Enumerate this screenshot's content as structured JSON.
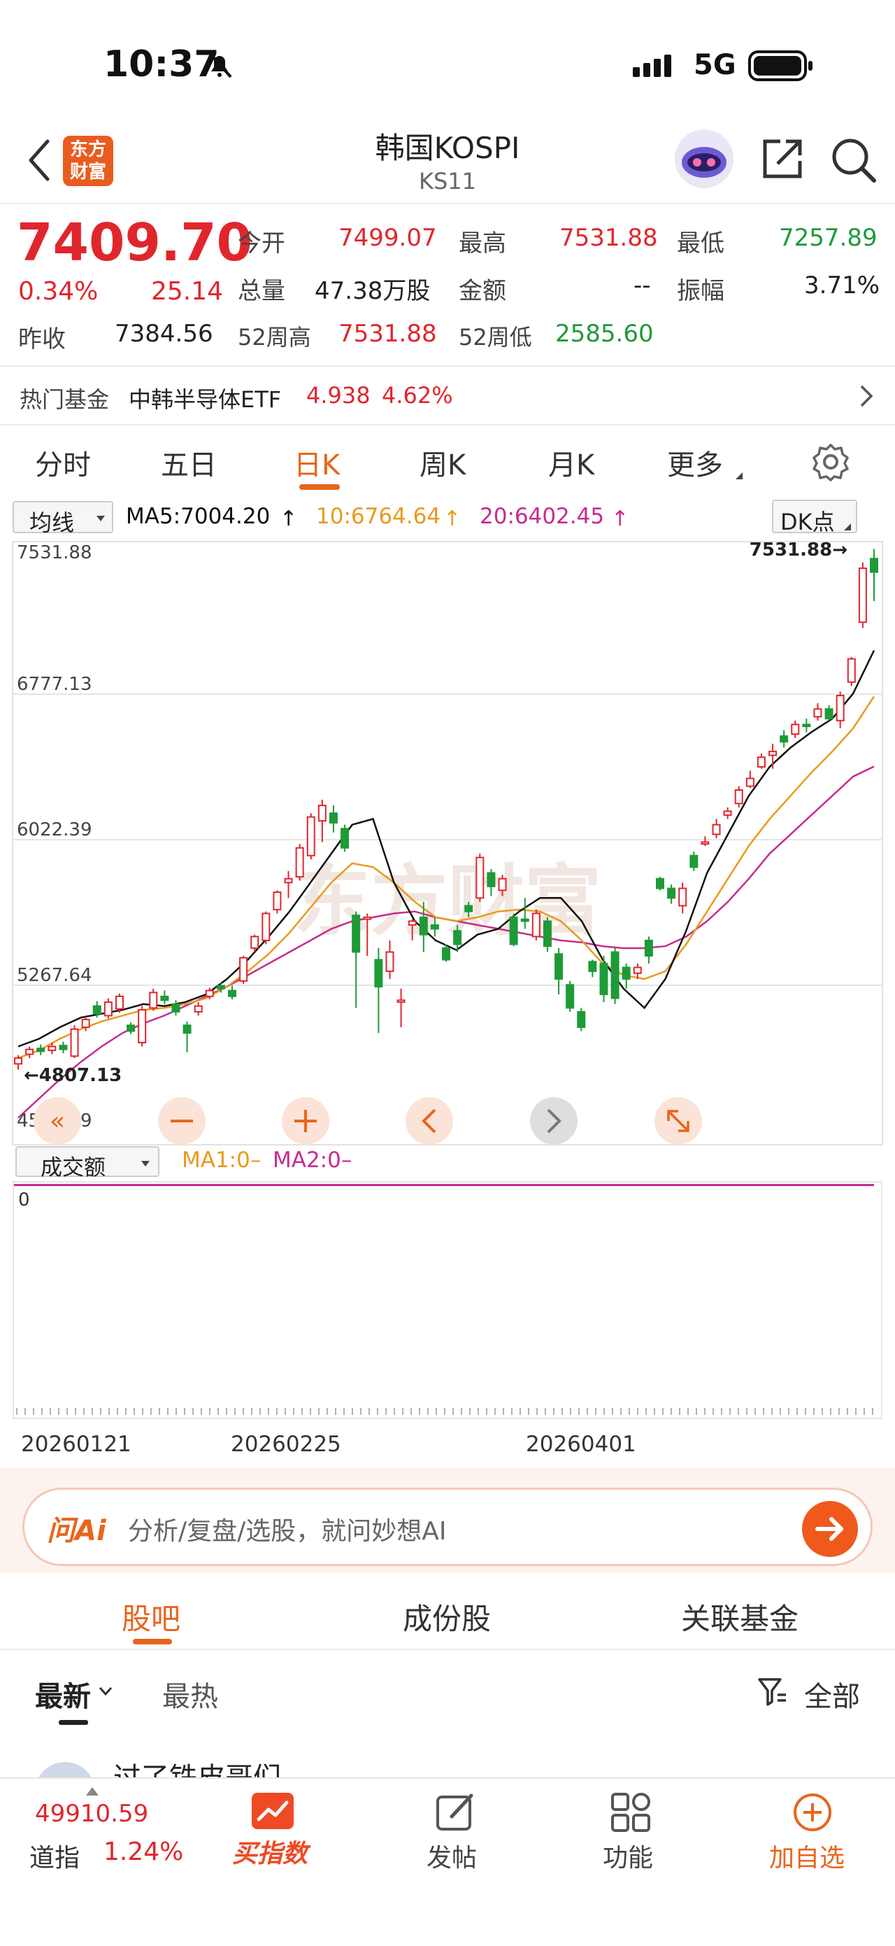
{
  "status_bar": {
    "time": "10:37",
    "network": "5G"
  },
  "header": {
    "title": "韩国KOSPI",
    "code": "KS11",
    "logo_text": "东方财富"
  },
  "quote": {
    "price": "7409.70",
    "change_pct": "0.34%",
    "change": "25.14",
    "prev_close_label": "昨收",
    "prev_close": "7384.56",
    "open_label": "今开",
    "open": "7499.07",
    "volume_label": "总量",
    "volume": "47.38万股",
    "wk52_high_label": "52周高",
    "wk52_high": "7531.88",
    "high_label": "最高",
    "high": "7531.88",
    "amount_label": "金额",
    "amount": "--",
    "wk52_low_label": "52周低",
    "wk52_low": "2585.60",
    "low_label": "最低",
    "low": "7257.89",
    "amplitude_label": "振幅",
    "amplitude": "3.71%"
  },
  "hot_fund": {
    "label": "热门基金",
    "name": "中韩半导体ETF",
    "price": "4.938",
    "pct": "4.62%"
  },
  "period_tabs": [
    "分时",
    "五日",
    "日K",
    "周K",
    "月K",
    "更多"
  ],
  "active_period": "日K",
  "ma_bar": {
    "selector": "均线",
    "ma5": "MA5:7004.20",
    "ma10": "10:6764.64",
    "ma20": "20:6402.45",
    "dk": "DK点"
  },
  "chart_data": {
    "type": "candlestick",
    "y_ticks": [
      "7531.88",
      "6777.13",
      "6022.39",
      "5267.64",
      "4512.89"
    ],
    "ylim": [
      4512.89,
      7531.88
    ],
    "max_label": "7531.88",
    "min_label": "4807.13",
    "x_labels": [
      "20260121",
      "20260225",
      "20260401"
    ],
    "candles": [
      [
        4860,
        4890,
        4830,
        4905
      ],
      [
        4910,
        4935,
        4890,
        4950
      ],
      [
        4940,
        4925,
        4905,
        4960
      ],
      [
        4930,
        4950,
        4910,
        4970
      ],
      [
        4955,
        4935,
        4915,
        4975
      ],
      [
        4900,
        5040,
        4890,
        5060
      ],
      [
        5050,
        5090,
        5030,
        5105
      ],
      [
        5160,
        5120,
        5100,
        5185
      ],
      [
        5110,
        5180,
        5095,
        5200
      ],
      [
        5145,
        5210,
        5125,
        5225
      ],
      [
        5060,
        5030,
        5015,
        5075
      ],
      [
        4970,
        5140,
        4950,
        5160
      ],
      [
        5150,
        5230,
        5135,
        5250
      ],
      [
        5210,
        5190,
        5170,
        5240
      ],
      [
        5170,
        5130,
        5110,
        5190
      ],
      [
        5060,
        5020,
        4920,
        5080
      ],
      [
        5130,
        5160,
        5110,
        5180
      ],
      [
        5210,
        5240,
        5195,
        5255
      ],
      [
        5265,
        5250,
        5230,
        5280
      ],
      [
        5240,
        5210,
        5195,
        5265
      ],
      [
        5290,
        5410,
        5275,
        5420
      ],
      [
        5460,
        5520,
        5440,
        5530
      ],
      [
        5500,
        5640,
        5480,
        5650
      ],
      [
        5660,
        5750,
        5640,
        5760
      ],
      [
        5800,
        5820,
        5720,
        5860
      ],
      [
        5830,
        5980,
        5810,
        6000
      ],
      [
        5940,
        6140,
        5920,
        6160
      ],
      [
        6120,
        6200,
        6010,
        6230
      ],
      [
        6160,
        6110,
        6060,
        6200
      ],
      [
        6080,
        5980,
        5960,
        6100
      ],
      [
        5630,
        5440,
        5150,
        5650
      ],
      [
        5610,
        5620,
        5420,
        5640
      ],
      [
        5400,
        5260,
        5020,
        5460
      ],
      [
        5340,
        5440,
        5300,
        5500
      ],
      [
        5180,
        5190,
        5050,
        5250
      ],
      [
        5580,
        5600,
        5500,
        5610
      ],
      [
        5620,
        5530,
        5440,
        5700
      ],
      [
        5580,
        5560,
        5520,
        5620
      ],
      [
        5460,
        5400,
        5390,
        5480
      ],
      [
        5550,
        5480,
        5440,
        5580
      ],
      [
        5680,
        5650,
        5620,
        5700
      ],
      [
        5720,
        5930,
        5700,
        5950
      ],
      [
        5850,
        5780,
        5730,
        5870
      ],
      [
        5760,
        5820,
        5730,
        5840
      ],
      [
        5620,
        5480,
        5470,
        5640
      ],
      [
        5610,
        5600,
        5560,
        5720
      ],
      [
        5520,
        5640,
        5500,
        5660
      ],
      [
        5600,
        5470,
        5440,
        5620
      ],
      [
        5430,
        5300,
        5220,
        5460
      ],
      [
        5270,
        5150,
        5130,
        5290
      ],
      [
        5130,
        5050,
        5030,
        5150
      ],
      [
        5390,
        5340,
        5310,
        5400
      ],
      [
        5380,
        5220,
        5180,
        5420
      ],
      [
        5440,
        5200,
        5170,
        5460
      ],
      [
        5360,
        5300,
        5250,
        5380
      ],
      [
        5330,
        5360,
        5300,
        5380
      ],
      [
        5500,
        5420,
        5380,
        5520
      ],
      [
        5820,
        5770,
        5760,
        5830
      ],
      [
        5770,
        5720,
        5690,
        5790
      ],
      [
        5680,
        5770,
        5640,
        5800
      ],
      [
        5940,
        5880,
        5860,
        5960
      ],
      [
        6000,
        6010,
        5990,
        6040
      ],
      [
        6050,
        6100,
        6030,
        6130
      ],
      [
        6150,
        6170,
        6130,
        6190
      ],
      [
        6210,
        6280,
        6190,
        6300
      ],
      [
        6300,
        6340,
        6290,
        6380
      ],
      [
        6400,
        6450,
        6390,
        6470
      ],
      [
        6460,
        6480,
        6390,
        6520
      ],
      [
        6560,
        6530,
        6500,
        6590
      ],
      [
        6570,
        6620,
        6550,
        6640
      ],
      [
        6620,
        6610,
        6580,
        6650
      ],
      [
        6660,
        6700,
        6640,
        6730
      ],
      [
        6700,
        6650,
        6640,
        6720
      ],
      [
        6640,
        6770,
        6600,
        6790
      ],
      [
        6840,
        6960,
        6820,
        6970
      ],
      [
        7150,
        7430,
        7120,
        7460
      ],
      [
        7480,
        7410,
        7260,
        7530
      ]
    ],
    "ma_lines": {
      "ma5": [
        4950,
        4990,
        5050,
        5100,
        5120,
        5140,
        5170,
        5160,
        5180,
        5220,
        5300,
        5400,
        5520,
        5650,
        5800,
        5950,
        6100,
        6130,
        5800,
        5600,
        5500,
        5450,
        5530,
        5560,
        5650,
        5720,
        5720,
        5600,
        5400,
        5250,
        5150,
        5300,
        5550,
        5850,
        6050,
        6250,
        6400,
        6500,
        6580,
        6650,
        6780,
        7004
      ],
      "ma10": [
        4890,
        4930,
        4990,
        5040,
        5080,
        5110,
        5140,
        5150,
        5170,
        5200,
        5260,
        5340,
        5430,
        5540,
        5670,
        5800,
        5900,
        5880,
        5800,
        5700,
        5620,
        5600,
        5620,
        5650,
        5660,
        5650,
        5600,
        5500,
        5380,
        5320,
        5300,
        5340,
        5480,
        5650,
        5820,
        5990,
        6130,
        6250,
        6370,
        6480,
        6600,
        6765
      ],
      "ma20": [
        4580,
        4680,
        4780,
        4870,
        4950,
        5020,
        5070,
        5110,
        5160,
        5210,
        5260,
        5320,
        5380,
        5440,
        5500,
        5560,
        5600,
        5620,
        5640,
        5650,
        5620,
        5600,
        5580,
        5560,
        5540,
        5520,
        5500,
        5490,
        5470,
        5460,
        5460,
        5470,
        5520,
        5600,
        5700,
        5820,
        5950,
        6050,
        6150,
        6250,
        6350,
        6402
      ]
    },
    "volume_selector": "成交额",
    "vol_ma1": "MA1:0–",
    "vol_ma2": "MA2:0–",
    "vol_zero": "0"
  },
  "watermark": "东方财富",
  "ai_box": {
    "badge": "问Ai",
    "placeholder": "分析/复盘/选股，就问妙想AI"
  },
  "bar_tabs": [
    "股吧",
    "成份股",
    "关联基金"
  ],
  "sub_tabs": {
    "latest": "最新",
    "hot": "最热",
    "filter": "全部"
  },
  "post_preview": "过了铁皮哥们",
  "bottom_nav": {
    "dow_value": "49910.59",
    "dow_name": "道指",
    "dow_pct": "1.24%",
    "buy_index": "买指数",
    "post": "发帖",
    "functions": "功能",
    "add_watch": "加自选"
  },
  "colors": {
    "up": "#e0262c",
    "down": "#1e9a38",
    "accent": "#e8651c",
    "ma5": "#111111",
    "ma10": "#e99a1e",
    "ma20": "#c72b8e"
  }
}
